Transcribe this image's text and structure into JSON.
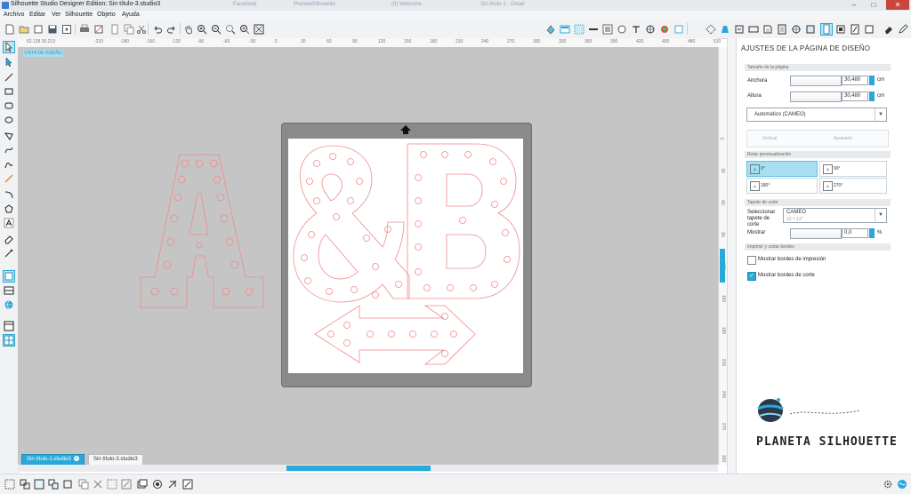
{
  "window": {
    "title": "Silhouette Studio Designer Edition: Sin título-3.studio3",
    "background_tabs": [
      "Facebook",
      "PlanetaSilhouette",
      "(9) Welcome",
      "Sin título-1 - Gmail"
    ],
    "controls": {
      "minimize": "–",
      "maximize": "□",
      "close": "✕"
    }
  },
  "menu": [
    "Archivo",
    "Editar",
    "Ver",
    "Silhouette",
    "Objeto",
    "Ayuda"
  ],
  "toolbar": {
    "left_icons": [
      "new-document-icon",
      "open-folder-icon",
      "open-icon",
      "save-icon",
      "save-library-icon",
      "print-icon",
      "print-cut-icon",
      "cut-icon",
      "copy-icon",
      "paste-icon",
      "scissors-icon",
      "undo-icon",
      "redo-icon",
      "pan-hand-icon",
      "zoom-in-icon",
      "zoom-out-icon",
      "zoom-select-icon",
      "zoom-drag-icon",
      "zoom-fit-icon"
    ],
    "right_icons": [
      "fill-color-icon",
      "line-color-icon",
      "gradient-icon",
      "fill-pattern-icon",
      "line-style-icon",
      "shadow-icon",
      "text-style-icon",
      "replicate-icon",
      "transform-icon",
      "offset-icon",
      "trace-icon",
      "library-icon",
      "store-icon",
      "page-setup-icon",
      "cut-settings-icon",
      "register-marks-icon",
      "send-to-silhouette-icon",
      "scan-icon",
      "eraser-icon",
      "pen-icon"
    ]
  },
  "left_tools": [
    "select-icon",
    "point-edit-icon",
    "line-icon",
    "rectangle-icon",
    "rounded-rectangle-icon",
    "ellipse-icon",
    "polygon-icon",
    "curve-icon",
    "arc-icon",
    "freehand-icon",
    "smooth-freehand-icon",
    "polyline-icon",
    "regular-polygon-icon",
    "text-icon",
    "eraser-icon",
    "knife-icon",
    "draw-pages-icon",
    "library-view-icon",
    "store-icon",
    "view-panel-icon",
    "grid-icon"
  ],
  "canvas": {
    "view_label": "VISTA DE DISEÑO",
    "coords": "62.128  30.213",
    "ruler_top": [
      "-210",
      "-180",
      "-150",
      "-120",
      "-90",
      "-60",
      "-30",
      "0",
      "30",
      "60",
      "90",
      "120",
      "150",
      "180",
      "210",
      "240",
      "270",
      "300",
      "330",
      "360",
      "390",
      "420",
      "450",
      "480",
      "510"
    ],
    "ruler_left": [
      "0",
      "30",
      "60",
      "90",
      "120",
      "150",
      "180",
      "210",
      "240",
      "270",
      "300",
      "330",
      "360",
      "390"
    ],
    "background_color": "#c5c5c5",
    "cut_line_color": "#f08a8a"
  },
  "doc_tabs": [
    {
      "label": "Sin título-1.studio3",
      "active": true
    },
    {
      "label": "Sin título-3.studio3",
      "active": false
    }
  ],
  "panel": {
    "title": "AJUSTES DE LA PÁGINA DE DISEÑO",
    "page_size_section": "Tamaño de la página",
    "width_label": "Anchura",
    "width_value": "30,480",
    "height_label": "Altura",
    "height_value": "30,480",
    "unit": "cm",
    "page_preset": "Automático (CAMEO)",
    "orientation_vertical": "Vertical",
    "orientation_landscape": "Apaisado",
    "rotate_section": "Rotar previsualización",
    "rotations": [
      {
        "label": "0°",
        "selected": true
      },
      {
        "label": "90°",
        "selected": false
      },
      {
        "label": "180°",
        "selected": false
      },
      {
        "label": "270°",
        "selected": false
      }
    ],
    "cut_mat_section": "Tapete de corte",
    "cut_mat_label": "Seleccionar tapete de corte",
    "cut_mat_value": "CAMEO",
    "cut_mat_sub": "12 × 12\"",
    "show_label": "Mostrar",
    "show_value": "0,0",
    "show_unit": "%",
    "print_section": "Imprimir y cortar bordes",
    "show_print_borders": {
      "label": "Mostrar bordes de impresión",
      "checked": false
    },
    "show_cut_borders": {
      "label": "Mostrar bordes de corte",
      "checked": true
    },
    "logo_text": "PLANETA SILHOUETTE"
  },
  "bottom_icons": [
    "group-icon",
    "ungroup-icon",
    "compound-path-icon",
    "release-compound-icon",
    "weld-icon",
    "delete-icon",
    "duplicate-icon",
    "select-all-icon",
    "layer-icon",
    "fill-icon",
    "replicate-icon",
    "modify-icon",
    "knife-icon"
  ],
  "bottom_right_icons": [
    "settings-gear-icon",
    "silhouette-logo-icon"
  ]
}
